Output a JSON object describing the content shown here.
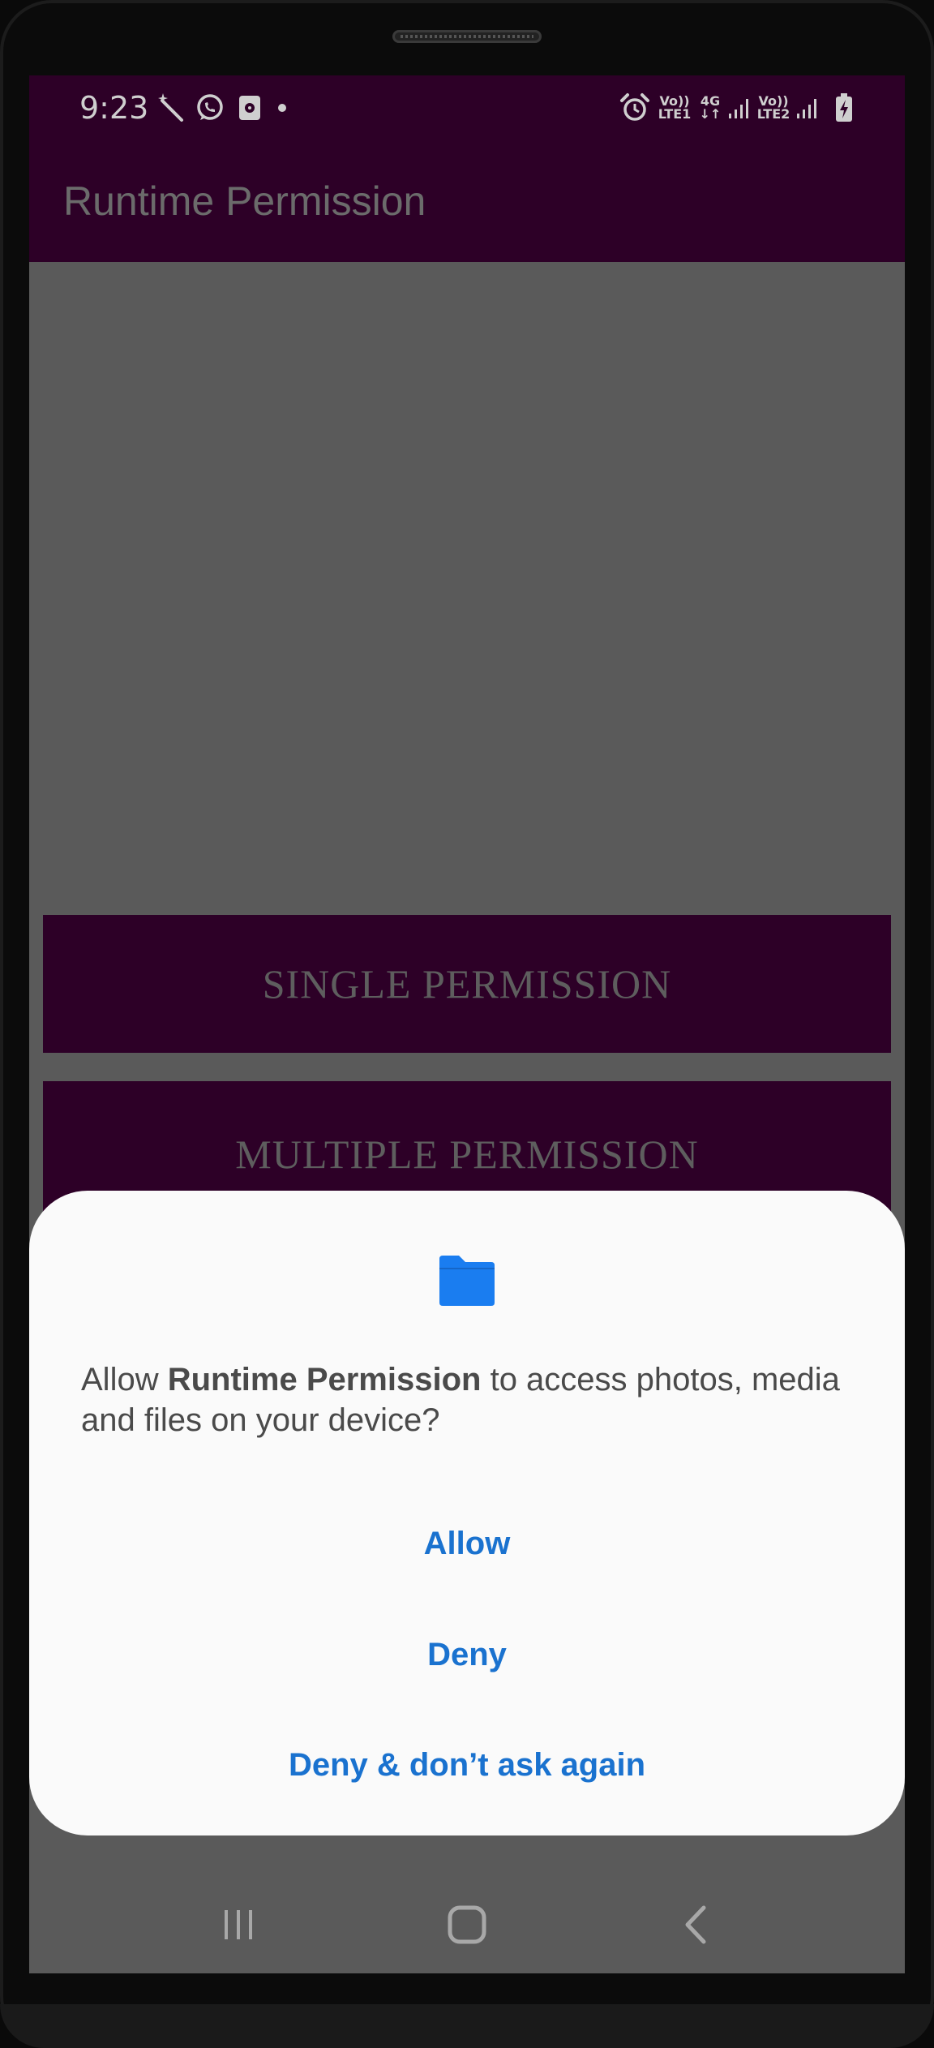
{
  "status_bar": {
    "time": "9:23",
    "icons": [
      "magic-wand-icon",
      "whatsapp-icon",
      "storage-icon",
      "dot-icon",
      "alarm-icon",
      "volte-lte1-icon",
      "4g-data-icon",
      "signal-icon",
      "volte-lte2-icon",
      "signal-icon",
      "battery-charging-icon"
    ],
    "volte1_top": "Vo))",
    "volte1_bottom": "LTE1",
    "data_type": "4G",
    "volte2_top": "Vo))",
    "volte2_bottom": "LTE2"
  },
  "app_bar": {
    "title": "Runtime Permission"
  },
  "main": {
    "single_button": "SINGLE PERMISSION",
    "multiple_button": "MULTIPLE PERMISSION"
  },
  "dialog": {
    "icon": "folder-icon",
    "message_prefix": "Allow ",
    "app_name": "Runtime Permission",
    "message_suffix": " to access photos, media and files on your device?",
    "allow_label": "Allow",
    "deny_label": "Deny",
    "deny_never_label": "Deny & don’t ask again"
  },
  "nav_bar": {
    "icons": [
      "recent-apps-icon",
      "home-icon",
      "back-icon"
    ]
  },
  "colors": {
    "app_bar": "#2d0027",
    "scrim": "#5a5a5a",
    "dialog_bg": "#fafafa",
    "action_text": "#1a72cf",
    "folder_icon": "#1a7df0"
  }
}
